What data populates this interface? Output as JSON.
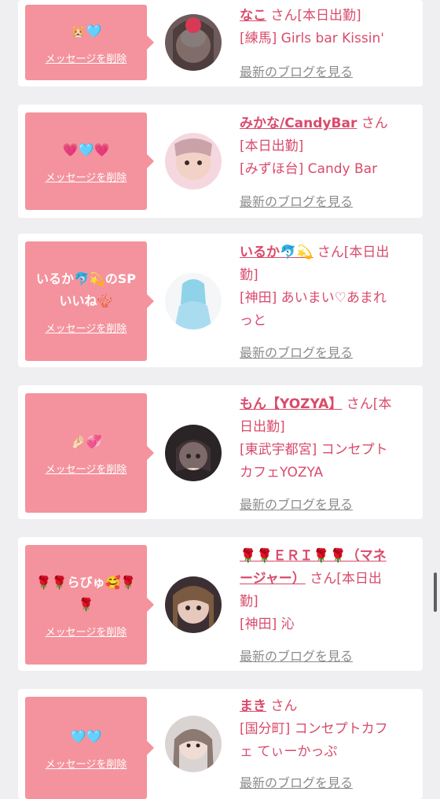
{
  "cards": [
    {
      "message": "🐹🩵",
      "delete_label": "メッセージを削除",
      "name": "なこ",
      "san": " さん[本日出勤]",
      "shop_line": "[練馬] Girls bar Kissin'",
      "shop_line2": "",
      "blog_label": "最新のブログを見る"
    },
    {
      "message": "💗🩵💗",
      "delete_label": "メッセージを削除",
      "name": "みかな/CandyBar",
      "san": " さん",
      "status_line": "[本日出勤]",
      "shop_line": "[みずほ台] Candy Bar",
      "blog_label": "最新のブログを見る"
    },
    {
      "message": "いるか🐬💫のSP",
      "message2": "いいね🪸",
      "delete_label": "メッセージを削除",
      "name": "いるか🐬💫",
      "san": " さん[本日出",
      "status_line": "勤]",
      "shop_line": "[神田] あいまい♡あまれ",
      "shop_line2": "っと",
      "blog_label": "最新のブログを見る"
    },
    {
      "message": "🤌🏻💞",
      "delete_label": "メッセージを削除",
      "name": "もん【YOZYA】",
      "san": " さん[本",
      "status_line": "日出勤]",
      "shop_line": "[東武宇都宮] コンセプト",
      "shop_line2": "カフェYOZYA",
      "blog_label": "最新のブログを見る"
    },
    {
      "message": "🌹🌹らびゅ🥰🌹",
      "message2": "🌹",
      "delete_label": "メッセージを削除",
      "name": "🌹🌹ＥＲＩ🌹🌹（マネ",
      "name2": "ージャー）",
      "san": " さん[本日出",
      "status_line": "勤]",
      "shop_line": "[神田] 沁",
      "blog_label": "最新のブログを見る"
    },
    {
      "message": "🩵🩵",
      "delete_label": "メッセージを削除",
      "name": "まき",
      "san": " さん",
      "shop_line": "[国分町] コンセプトカフ",
      "shop_line2": "ェ てぃーかっぷ",
      "blog_label": "最新のブログを見る"
    }
  ],
  "colors": {
    "bubble": "#f4939d",
    "name": "#d94b6b",
    "background": "#efeff1"
  }
}
